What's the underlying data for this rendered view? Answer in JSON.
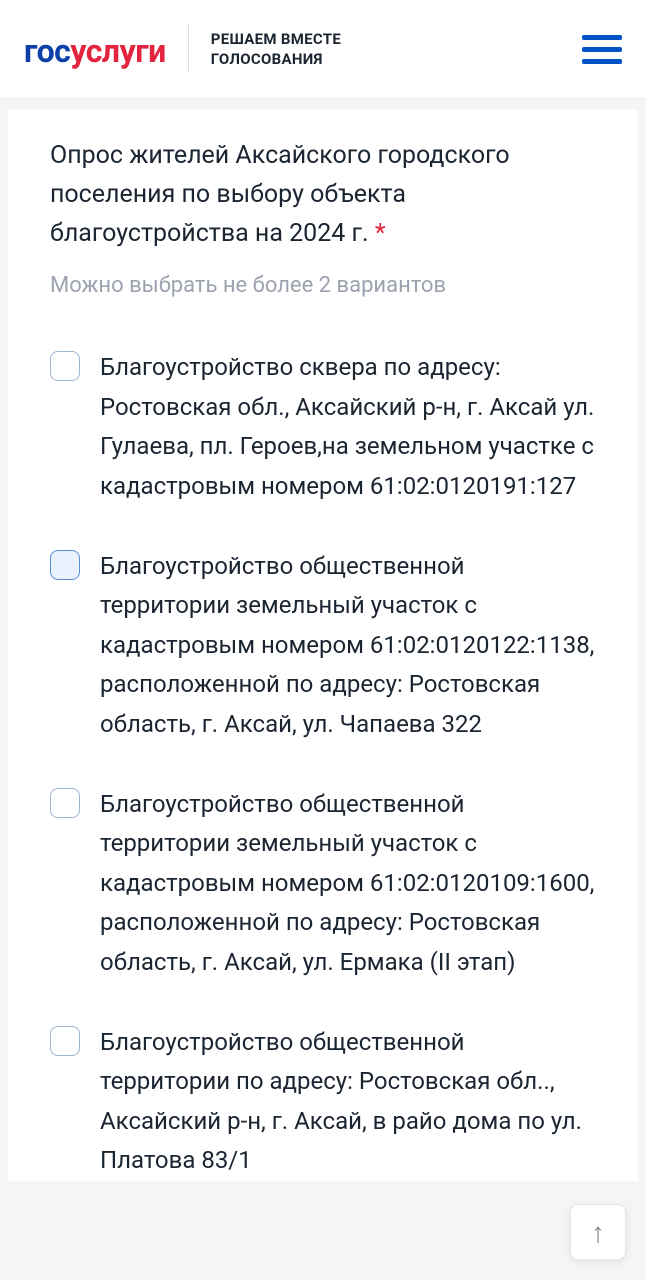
{
  "header": {
    "logo_part1": "гос",
    "logo_part2": "услуги",
    "subtitle_line1": "РЕШАЕМ ВМЕСТЕ",
    "subtitle_line2": "ГОЛОСОВАНИЯ"
  },
  "poll": {
    "title": "Опрос жителей Аксайского городского поселения по выбору объекта благоустройства на 2024 г.",
    "asterisk": "*",
    "hint": "Можно выбрать не более 2 вариантов",
    "options": [
      {
        "text": "Благоустройство сквера по адресу: Ростовская обл., Аксайский р-н, г. Аксай ул. Гулаева, пл. Героев,на земельном участке с кадастровым номером 61:02:0120191:127",
        "selected": false
      },
      {
        "text": "Благоустройство общественной территории земельный участок с кадастровым номером 61:02:0120122:1138, расположенной по адресу: Ростовская область, г. Аксай, ул. Чапаева 322",
        "selected": true
      },
      {
        "text": "Благоустройство общественной территории земельный участок с кадастровым номером 61:02:0120109:1600, расположенной по адресу: Ростовская область, г. Аксай, ул. Ермака (II этап)",
        "selected": false
      },
      {
        "text": "Благоустройство общественной территории по адресу: Ростовская обл.., Аксайский р-н, г. Аксай, в райо дома по ул. Платова 83/1",
        "selected": false
      }
    ]
  }
}
